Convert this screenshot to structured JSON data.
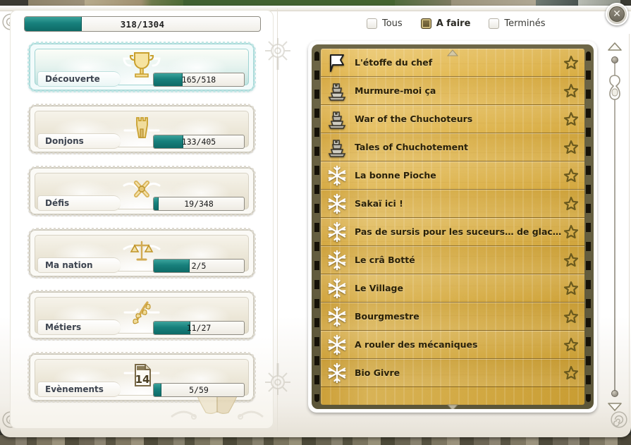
{
  "window": {
    "close_label": "✕",
    "accent_teal": "#17807c",
    "parchment_gold": "#e2b649",
    "board_border": "#5c5639"
  },
  "left": {
    "global_progress": {
      "label": "318/1304",
      "current": 318,
      "total": 1304,
      "percent": 24.4
    },
    "categories": [
      {
        "label": "Découverte",
        "progress_label": "165/518",
        "current": 165,
        "total": 518,
        "percent": 31.9,
        "icon": "trophy-icon",
        "selected": true
      },
      {
        "label": "Donjons",
        "progress_label": "133/405",
        "current": 133,
        "total": 405,
        "percent": 32.8,
        "icon": "castle-tower-icon",
        "selected": false
      },
      {
        "label": "Défis",
        "progress_label": "19/348",
        "current": 19,
        "total": 348,
        "percent": 5.5,
        "icon": "crossed-swords-icon",
        "selected": false
      },
      {
        "label": "Ma nation",
        "progress_label": "2/5",
        "current": 2,
        "total": 5,
        "percent": 40,
        "icon": "scales-icon",
        "selected": false
      },
      {
        "label": "Métiers",
        "progress_label": "11/27",
        "current": 11,
        "total": 27,
        "percent": 40.7,
        "icon": "wheat-branch-icon",
        "selected": false
      },
      {
        "label": "Evènements",
        "progress_label": "5/59",
        "current": 5,
        "total": 59,
        "percent": 8.5,
        "icon": "calendar-icon",
        "calendar_day": "14",
        "selected": false
      }
    ]
  },
  "right": {
    "filters": [
      {
        "label": "Tous",
        "selected": false
      },
      {
        "label": "A faire",
        "selected": true
      },
      {
        "label": "Terminés",
        "selected": false
      }
    ],
    "quests": [
      {
        "name": "L'étoffe du chef",
        "icon": "banner-icon"
      },
      {
        "name": "Murmure-moi ça",
        "icon": "stone-statue-icon"
      },
      {
        "name": "War of the Chuchoteurs",
        "icon": "stone-statue-icon"
      },
      {
        "name": "Tales of Chuchotement",
        "icon": "stone-statue-icon"
      },
      {
        "name": "La bonne Pioche",
        "icon": "snowflake-icon"
      },
      {
        "name": "Sakaï ici !",
        "icon": "snowflake-icon"
      },
      {
        "name": "Pas de sursis pour les suceurs… de glace !",
        "icon": "snowflake-icon"
      },
      {
        "name": "Le crâ Botté",
        "icon": "snowflake-icon"
      },
      {
        "name": "Le Village",
        "icon": "snowflake-icon"
      },
      {
        "name": "Bourgmestre",
        "icon": "snowflake-icon"
      },
      {
        "name": "A rouler des mécaniques",
        "icon": "snowflake-icon"
      },
      {
        "name": "Bio Givre",
        "icon": "snowflake-icon"
      }
    ],
    "scrollbar": {
      "position_percent": 8
    }
  }
}
